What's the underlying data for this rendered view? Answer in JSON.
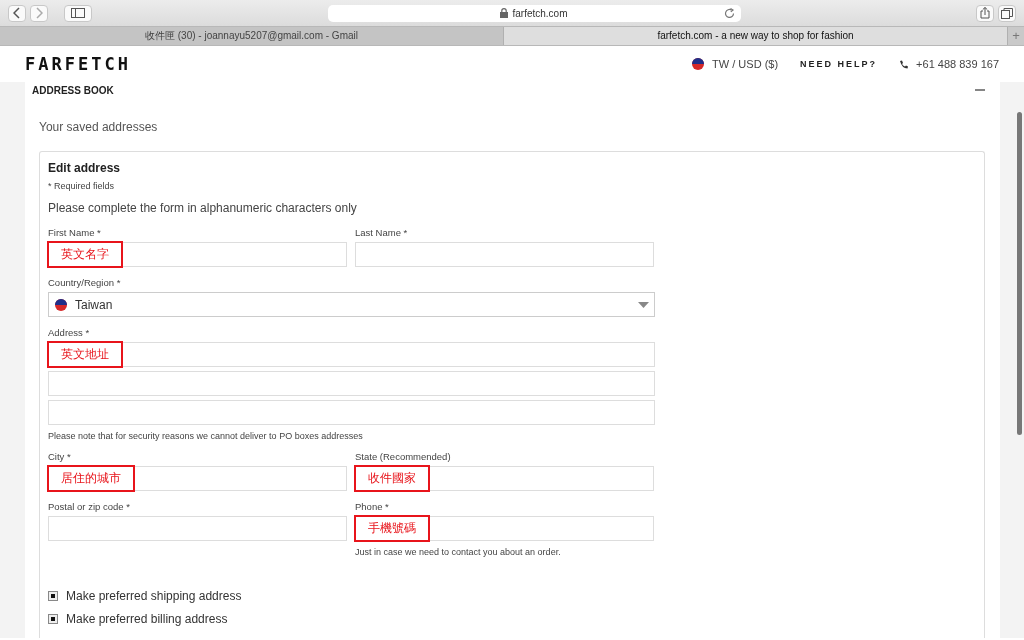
{
  "browser": {
    "address": "farfetch.com",
    "tabs": [
      {
        "label": "收件匣 (30) - joannayu5207@gmail.com - Gmail",
        "selected": false
      },
      {
        "label": "farfetch.com - a new way to shop for fashion",
        "selected": true
      }
    ],
    "new_tab": "+"
  },
  "header": {
    "logo": "FARFETCH",
    "locale": "TW / USD ($)",
    "help": "NEED HELP?",
    "phone": "+61 488 839 167"
  },
  "section": {
    "title": "ADDRESS BOOK",
    "expanded": true,
    "subtitle": "Your saved addresses"
  },
  "form": {
    "title": "Edit address",
    "required_note": "* Required fields",
    "instruction": "Please complete the form in alphanumeric characters only",
    "rows": [
      {
        "fields": [
          {
            "kind": "text",
            "label": "First Name *",
            "annotation": "英文名字"
          },
          {
            "kind": "text",
            "label": "Last Name *"
          }
        ]
      },
      {
        "fields": [
          {
            "kind": "select",
            "label": "Country/Region *",
            "value": "Taiwan"
          }
        ]
      },
      {
        "fields": [
          {
            "kind": "text",
            "label": "Address *",
            "annotation": "英文地址"
          }
        ]
      },
      {
        "fields": [
          {
            "kind": "text"
          }
        ]
      },
      {
        "fields": [
          {
            "kind": "text",
            "note": "Please note that for security reasons we cannot deliver to PO boxes addresses"
          }
        ]
      },
      {
        "fields": [
          {
            "kind": "text",
            "label": "City *",
            "annotation": "居住的城市"
          },
          {
            "kind": "text",
            "label": "State (Recommended)",
            "annotation": "收件國家"
          }
        ]
      },
      {
        "fields": [
          {
            "kind": "text",
            "label": "Postal or zip code *"
          },
          {
            "kind": "text",
            "label": "Phone *",
            "annotation": "手機號碼",
            "note": "Just in case we need to contact you about an order."
          }
        ]
      }
    ],
    "options": [
      {
        "label": "Make preferred shipping address",
        "checked": true
      },
      {
        "label": "Make preferred billing address",
        "checked": true
      }
    ]
  }
}
